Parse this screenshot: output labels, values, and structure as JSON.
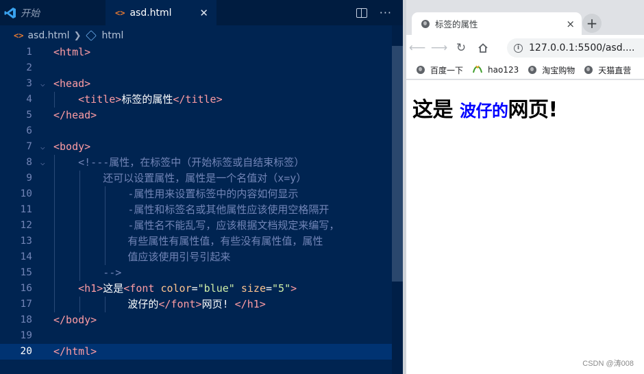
{
  "editor": {
    "tabs": [
      {
        "label": "开始",
        "active": false
      },
      {
        "label": "asd.html",
        "active": true
      }
    ],
    "breadcrumb": [
      "asd.html",
      "html"
    ],
    "lines": [
      {
        "n": "1",
        "parts": [
          [
            "tag",
            "<html>"
          ]
        ]
      },
      {
        "n": "2",
        "parts": []
      },
      {
        "n": "3",
        "parts": [
          [
            "tag",
            "<head>"
          ]
        ]
      },
      {
        "n": "4",
        "parts": [
          [
            "txt",
            "    "
          ],
          [
            "tag",
            "<title>"
          ],
          [
            "txt",
            "标签的属性"
          ],
          [
            "tag",
            "</title>"
          ]
        ]
      },
      {
        "n": "5",
        "parts": [
          [
            "tag",
            "</head>"
          ]
        ]
      },
      {
        "n": "6",
        "parts": []
      },
      {
        "n": "7",
        "parts": [
          [
            "tag",
            "<body>"
          ]
        ]
      },
      {
        "n": "8",
        "parts": [
          [
            "cmt",
            "    <!---属性，在标签中（开始标签或自结束标签）"
          ]
        ]
      },
      {
        "n": "9",
        "parts": [
          [
            "cmt",
            "        还可以设置属性，属性是一个名值对（x=y）"
          ]
        ]
      },
      {
        "n": "10",
        "parts": [
          [
            "cmt",
            "            -属性用来设置标签中的内容如何显示"
          ]
        ]
      },
      {
        "n": "11",
        "parts": [
          [
            "cmt",
            "            -属性和标签名或其他属性应该使用空格隔开"
          ]
        ]
      },
      {
        "n": "12",
        "parts": [
          [
            "cmt",
            "            -属性名不能乱写，应该根据文档规定来编写，"
          ]
        ]
      },
      {
        "n": "13",
        "parts": [
          [
            "cmt",
            "            有些属性有属性值，有些没有属性值，属性"
          ]
        ]
      },
      {
        "n": "14",
        "parts": [
          [
            "cmt",
            "            值应该使用引号引起来"
          ]
        ]
      },
      {
        "n": "15",
        "parts": [
          [
            "cmt",
            "        -->"
          ]
        ]
      },
      {
        "n": "16",
        "parts": [
          [
            "txt",
            "    "
          ],
          [
            "tag",
            "<h1>"
          ],
          [
            "txt",
            "这是"
          ],
          [
            "tag",
            "<font "
          ],
          [
            "attr",
            "color"
          ],
          [
            "txt",
            "="
          ],
          [
            "str",
            "\"blue\""
          ],
          [
            "txt",
            " "
          ],
          [
            "attr",
            "size"
          ],
          [
            "txt",
            "="
          ],
          [
            "str",
            "\"5\""
          ],
          [
            "tag",
            ">"
          ]
        ]
      },
      {
        "n": "17",
        "parts": [
          [
            "txt",
            "            波仔的"
          ],
          [
            "tag",
            "</font>"
          ],
          [
            "txt",
            "网页! "
          ],
          [
            "tag",
            "</h1>"
          ]
        ]
      },
      {
        "n": "18",
        "parts": [
          [
            "tag",
            "</body>"
          ]
        ]
      },
      {
        "n": "19",
        "parts": []
      },
      {
        "n": "20",
        "parts": [
          [
            "tag",
            "</html>"
          ]
        ],
        "current": true
      }
    ],
    "folds": [
      "3",
      "7",
      "8"
    ]
  },
  "browser": {
    "tab_title": "标签的属性",
    "tab_close": "×",
    "new_tab": "+",
    "url": "127.0.0.1:5500/asd....",
    "bookmarks": [
      {
        "label": "百度一下",
        "icon": "globe-icon"
      },
      {
        "label": "hao123",
        "icon": "hao123-icon"
      },
      {
        "label": "淘宝购物",
        "icon": "globe-icon"
      },
      {
        "label": "天猫直营",
        "icon": "globe-icon"
      }
    ],
    "page": {
      "h1_before": "这是 ",
      "h1_font": "波仔的",
      "h1_after": "网页!"
    },
    "watermark": "CSDN @涛008"
  },
  "colors": {
    "editor_bg": "#002451",
    "tag": "#ff9da4",
    "attr": "#ffc58f",
    "string": "#d1f1a9",
    "comment": "#7285b7",
    "font_blue": "#0000ff"
  }
}
